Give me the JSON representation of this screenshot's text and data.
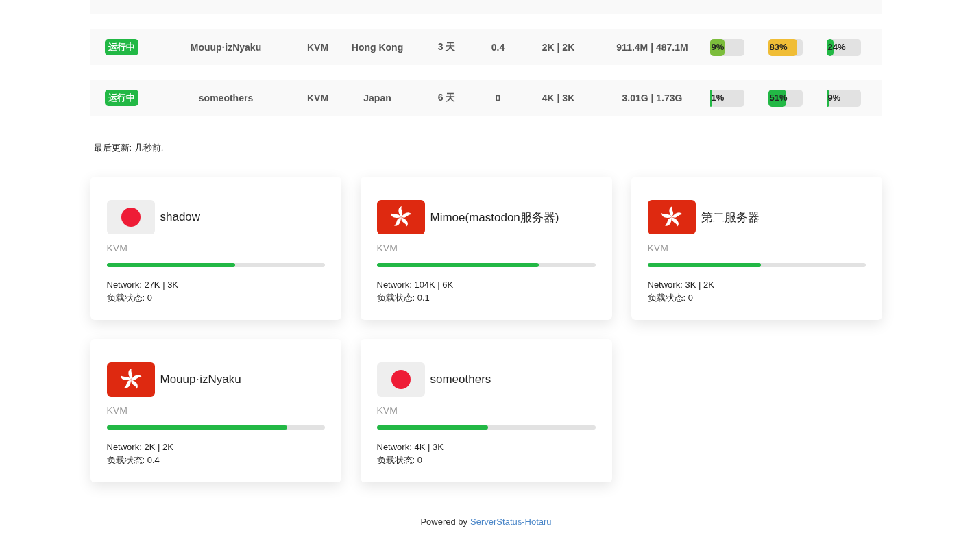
{
  "servers": [
    {
      "status": "运行中",
      "name": "Mouup·izNyaku",
      "type": "KVM",
      "location": "Hong Kong",
      "uptime": "3 天",
      "load": "0.4",
      "network": "2K | 2K",
      "traffic": "911.4M | 487.1M",
      "bars": [
        {
          "label": "9%",
          "level": 0.42,
          "color": "#7cbd3c"
        },
        {
          "label": "83%",
          "level": 0.84,
          "color": "#f0bd36"
        },
        {
          "label": "24%",
          "level": 0.2,
          "color": "#22b845"
        }
      ]
    },
    {
      "status": "运行中",
      "name": "someothers",
      "type": "KVM",
      "location": "Japan",
      "uptime": "6 天",
      "load": "0",
      "network": "4K | 3K",
      "traffic": "3.01G | 1.73G",
      "bars": [
        {
          "label": "1%",
          "level": 0.02,
          "color": "#22b845"
        },
        {
          "label": "51%",
          "level": 0.52,
          "color": "#22b845"
        },
        {
          "label": "9%",
          "level": 0.06,
          "color": "#22b845"
        }
      ]
    }
  ],
  "last_update": "最后更新: 几秒前.",
  "cards": [
    {
      "kind": "jp",
      "name": "shadow",
      "type": "KVM",
      "level": 0.59,
      "network": "Network: 27K | 3K",
      "load": "负载状态: 0"
    },
    {
      "kind": "hk",
      "name": "Mimoe(mastodon服务器)",
      "type": "KVM",
      "level": 0.74,
      "network": "Network: 104K | 6K",
      "load": "负载状态: 0.1"
    },
    {
      "kind": "hk",
      "name": "第二服务器",
      "type": "KVM",
      "level": 0.52,
      "network": "Network: 3K | 2K",
      "load": "负载状态: 0"
    },
    {
      "kind": "hk",
      "name": "Mouup·izNyaku",
      "type": "KVM",
      "level": 0.83,
      "network": "Network: 2K | 2K",
      "load": "负载状态: 0.4"
    },
    {
      "kind": "jp",
      "name": "someothers",
      "type": "KVM",
      "level": 0.51,
      "network": "Network: 4K | 3K",
      "load": "负载状态: 0"
    }
  ],
  "footer": {
    "text": "Powered by",
    "link": "ServerStatus-Hotaru"
  }
}
